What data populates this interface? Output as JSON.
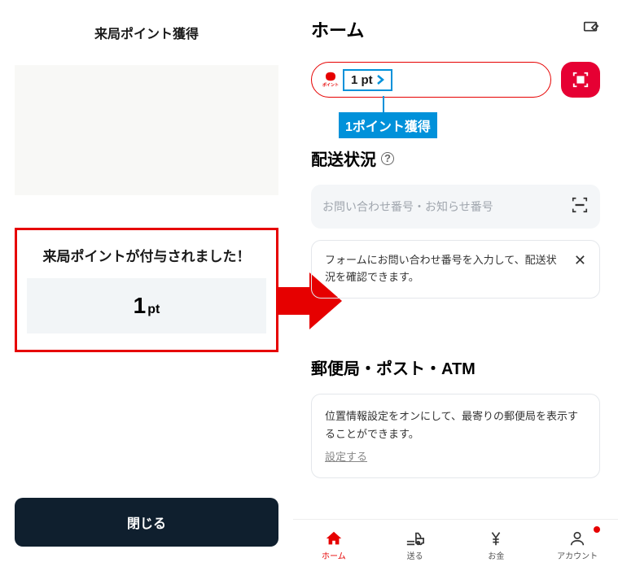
{
  "left": {
    "title": "来局ポイント獲得",
    "award_message": "来局ポイントが付与されました！",
    "points_value": "1",
    "points_unit": "pt",
    "close_label": "閉じる"
  },
  "callout": {
    "label": "1ポイント獲得"
  },
  "right": {
    "header_title": "ホーム",
    "points_logo_text": "ポイント",
    "points_display": "1 pt",
    "delivery": {
      "title": "配送状況",
      "search_placeholder": "お問い合わせ番号・お知らせ番号",
      "hint": "フォームにお問い合わせ番号を入力して、配送状況を確認できます。"
    },
    "location": {
      "title": "郵便局・ポスト・ATM",
      "hint": "位置情報設定をオンにして、最寄りの郵便局を表示することができます。",
      "link": "設定する"
    }
  },
  "tabs": {
    "home": "ホーム",
    "send": "送る",
    "money": "お金",
    "account": "アカウント"
  },
  "colors": {
    "red": "#e60000",
    "blue": "#0091da",
    "dark": "#0f1f2e"
  }
}
